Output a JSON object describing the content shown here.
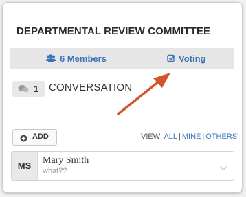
{
  "committee": {
    "title": "DEPARTMENTAL REVIEW COMMITTEE",
    "members_label": "6 Members",
    "voting_label": "Voting"
  },
  "conversation": {
    "count": "1",
    "label": "CONVERSATION"
  },
  "actions": {
    "add_label": "ADD",
    "view_prefix": "VIEW:",
    "view_all": "ALL",
    "view_mine": "MINE",
    "view_others": "OTHERS'"
  },
  "message": {
    "initials": "MS",
    "author": "Mary Smith",
    "preview": "what??"
  },
  "colors": {
    "link": "#3b73b9",
    "subbar_bg": "#e6e6e6",
    "arrow": "#d2552c"
  },
  "icons": {
    "members": "users-icon",
    "voting": "checkbox-icon",
    "conversation": "chat-bubbles-icon",
    "add": "plus-circle-icon",
    "expand": "chevron-down-icon"
  }
}
